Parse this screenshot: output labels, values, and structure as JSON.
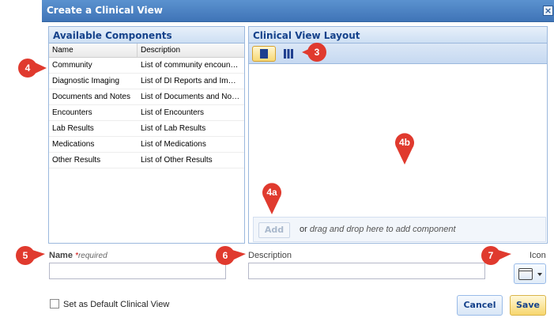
{
  "dialog": {
    "title": "Create a Clinical View",
    "close_icon": "close-icon"
  },
  "available_components": {
    "header": "Available Components",
    "columns": [
      "Name",
      "Description"
    ],
    "rows": [
      {
        "name": "Community",
        "description": "List of community encounters"
      },
      {
        "name": "Diagnostic Imaging",
        "description": "List of DI Reports and Imag..."
      },
      {
        "name": "Documents and Notes",
        "description": "List of Documents and Notes"
      },
      {
        "name": "Encounters",
        "description": "List of Encounters"
      },
      {
        "name": "Lab Results",
        "description": "List of Lab Results"
      },
      {
        "name": "Medications",
        "description": "List of Medications"
      },
      {
        "name": "Other Results",
        "description": "List of Other Results"
      }
    ]
  },
  "layout_panel": {
    "header": "Clinical View Layout",
    "one_column_icon": "one-column-layout-icon",
    "three_column_icon": "three-column-layout-icon",
    "add_label": "Add",
    "or_text": "or",
    "drop_hint": "drag and drop here to add component"
  },
  "form": {
    "name_label": "Name",
    "required_star": "*",
    "required_text": "required",
    "description_label": "Description",
    "icon_label": "Icon",
    "name_value": "",
    "description_value": "",
    "default_label": "Set as Default Clinical View",
    "cancel_label": "Cancel",
    "save_label": "Save"
  },
  "callouts": {
    "m3": "3",
    "m4": "4",
    "m4a": "4a",
    "m4b": "4b",
    "m5": "5",
    "m6": "6",
    "m7": "7"
  },
  "colors": {
    "titlebar": "#4a7fc1",
    "panel_header_text": "#15428b",
    "callout": "#e03a2e",
    "save_button": "#f7d66d"
  }
}
